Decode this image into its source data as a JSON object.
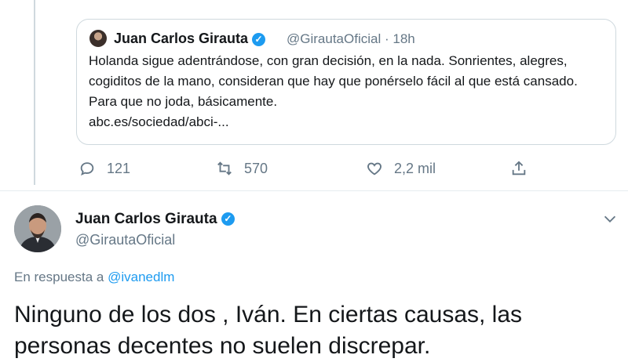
{
  "quoted_tweet": {
    "author_name": "Juan Carlos Girauta",
    "verified_glyph": "✓",
    "handle": "@GirautaOficial",
    "separator": "·",
    "time": "18h",
    "text": "Holanda sigue adentrándose, con gran decisión, en la nada. Sonrientes, alegres, cogiditos de la mano, consideran que hay que ponérselo fácil al que está cansado. Para que no joda, básicamente.",
    "link": "abc.es/sociedad/abci-..."
  },
  "actions": {
    "replies": "121",
    "retweets": "570",
    "likes": "2,2 mil"
  },
  "tweet": {
    "author_name": "Juan Carlos Girauta",
    "verified_glyph": "✓",
    "handle": "@GirautaOficial",
    "reply_prefix": "En respuesta a",
    "reply_mention": "@ivanedlm",
    "text": "Ninguno de los dos , Iván. En ciertas causas, las personas decentes no suelen discrepar."
  },
  "icons": {
    "reply": "reply-icon",
    "retweet": "retweet-icon",
    "like": "heart-icon",
    "share": "share-icon",
    "menu": "chevron-down-icon",
    "verified": "verified-badge-icon"
  },
  "colors": {
    "accent": "#1d9bf0",
    "text": "#14171a",
    "secondary": "#657786",
    "border": "#cfd9de"
  }
}
